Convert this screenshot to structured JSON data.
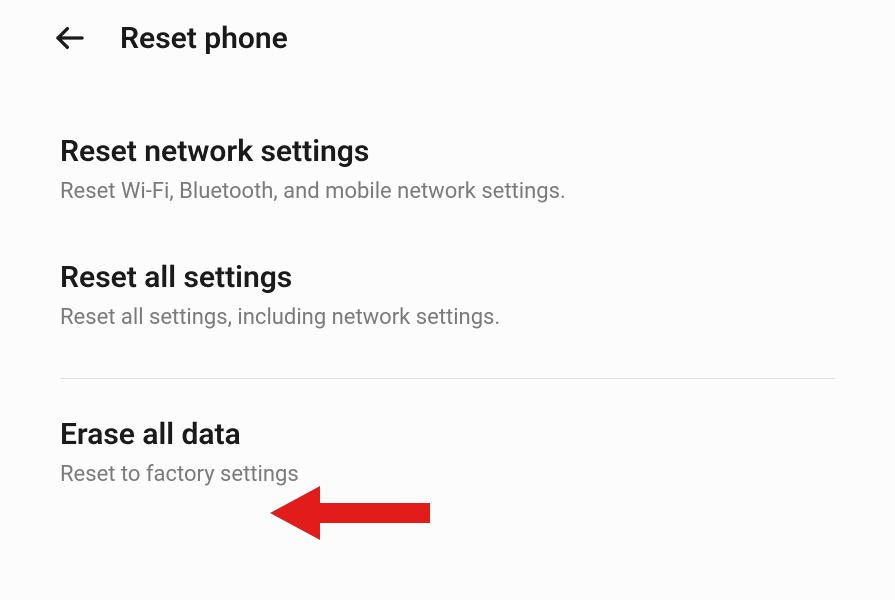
{
  "header": {
    "title": "Reset phone"
  },
  "options": [
    {
      "title": "Reset network settings",
      "subtitle": "Reset Wi-Fi, Bluetooth, and mobile network settings."
    },
    {
      "title": "Reset all settings",
      "subtitle": "Reset all settings, including network settings."
    },
    {
      "title": "Erase all data",
      "subtitle": "Reset to factory settings"
    }
  ]
}
